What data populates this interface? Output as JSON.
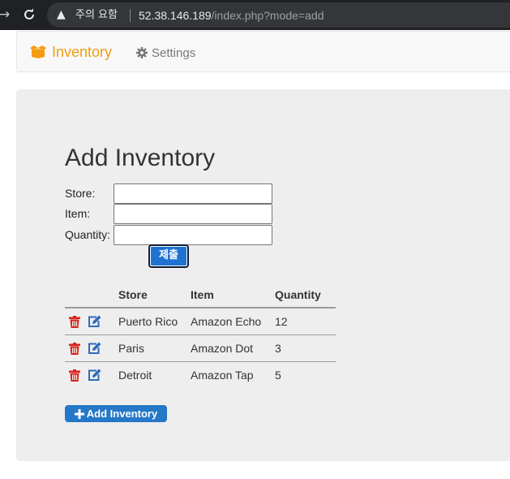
{
  "browser": {
    "security_label": "주의 요함",
    "url_host": "52.38.146.189",
    "url_path": "/index.php?mode=add"
  },
  "navbar": {
    "brand": "Inventory",
    "settings": "Settings"
  },
  "page": {
    "title": "Add Inventory"
  },
  "form": {
    "store_label": "Store:",
    "item_label": "Item:",
    "quantity_label": "Quantity:",
    "store_value": "",
    "item_value": "",
    "quantity_value": "",
    "submit_label": "제출"
  },
  "table": {
    "headers": [
      "Store",
      "Item",
      "Quantity"
    ],
    "rows": [
      {
        "store": "Puerto Rico",
        "item": "Amazon Echo",
        "quantity": "12"
      },
      {
        "store": "Paris",
        "item": "Amazon Dot",
        "quantity": "3"
      },
      {
        "store": "Detroit",
        "item": "Amazon Tap",
        "quantity": "5"
      }
    ]
  },
  "add_button_label": "Add Inventory",
  "colors": {
    "brand": "#f39c12",
    "trash": "#d9251c",
    "edit": "#2e6bb8",
    "primary_button": "#2578c8"
  },
  "icons": [
    "back-arrow-icon",
    "reload-icon",
    "warning-icon",
    "box-open-icon",
    "gear-icon",
    "trash-icon",
    "edit-icon",
    "plus-icon"
  ]
}
